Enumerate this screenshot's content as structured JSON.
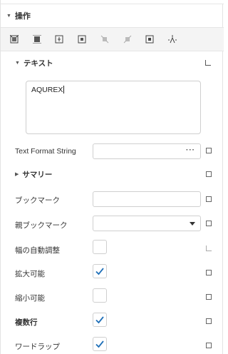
{
  "section": {
    "title": "操作"
  },
  "toolbar": {
    "tools": [
      {
        "icon": "align-left-icon"
      },
      {
        "icon": "align-center-icon"
      },
      {
        "icon": "align-right-icon"
      },
      {
        "icon": "align-top-icon"
      },
      {
        "icon": "align-middle-icon"
      },
      {
        "icon": "align-bottom-icon"
      },
      {
        "icon": "center-frame-icon"
      },
      {
        "icon": "distribute-icon"
      }
    ]
  },
  "text_section": {
    "title": "テキスト",
    "value": "AQUREX"
  },
  "properties": {
    "text_format_string": {
      "label": "Text Format String",
      "value": "",
      "button": "···"
    },
    "summary": {
      "title": "サマリー"
    },
    "bookmark": {
      "label": "ブックマーク",
      "value": ""
    },
    "parent_bookmark": {
      "label": "親ブックマーク",
      "value": ""
    },
    "auto_width": {
      "label": "幅の自動調整",
      "checked": false
    },
    "can_grow": {
      "label": "拡大可能",
      "checked": true
    },
    "can_shrink": {
      "label": "縮小可能",
      "checked": false
    },
    "multiline": {
      "label": "複数行",
      "checked": true
    },
    "word_wrap": {
      "label": "ワードラップ",
      "checked": true
    }
  },
  "colors": {
    "check": "#1e6fb8",
    "border": "#cfcfcf",
    "toolbar_bg": "#f4f4f4"
  }
}
